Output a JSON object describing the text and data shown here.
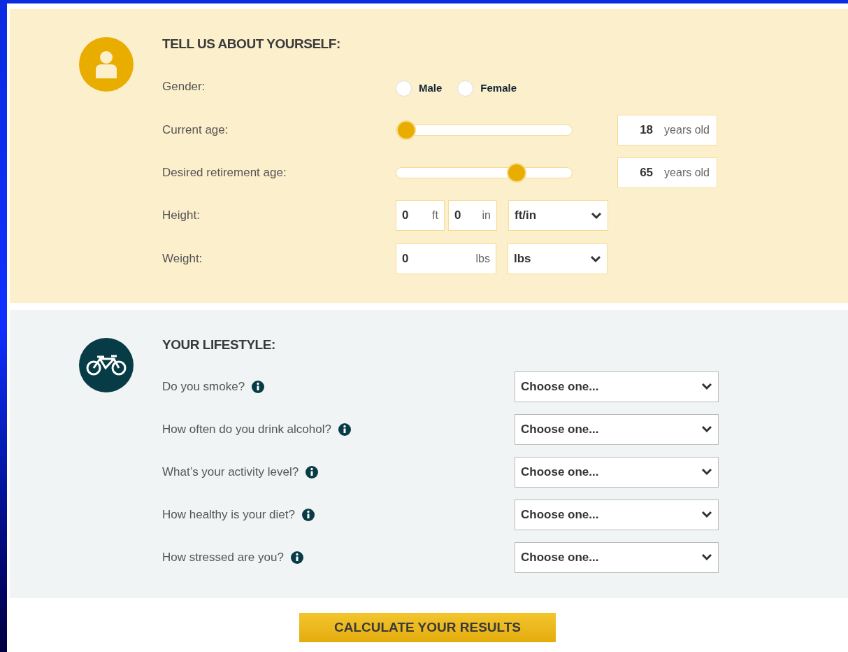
{
  "about": {
    "title": "TELL US ABOUT YOURSELF:",
    "gender": {
      "label": "Gender:",
      "options": [
        {
          "label": "Male",
          "selected": false
        },
        {
          "label": "Female",
          "selected": false
        }
      ]
    },
    "sliders": [
      {
        "label": "Current age:",
        "level": 0,
        "value": "18",
        "unit": "years old"
      },
      {
        "label": "Desired retirement age:",
        "level": 0.71,
        "value": "65",
        "unit": "years old"
      }
    ],
    "height": {
      "label": "Height:",
      "fields": [
        {
          "value": "0",
          "unit": "ft"
        },
        {
          "value": "0",
          "unit": "in"
        }
      ],
      "select": "ft/in"
    },
    "weight": {
      "label": "Weight:",
      "fields": [
        {
          "value": "0",
          "unit": "lbs"
        }
      ],
      "select": "lbs"
    }
  },
  "lifestyle": {
    "title": "YOUR LIFESTYLE:",
    "questions": [
      {
        "label": "Do you smoke?",
        "select": "Choose one..."
      },
      {
        "label": "How often do you drink alcohol?",
        "select": "Choose one..."
      },
      {
        "label": "What’s your activity level?",
        "select": "Choose one..."
      },
      {
        "label": "How healthy is your diet?",
        "select": "Choose one..."
      },
      {
        "label": "How stressed are you?",
        "select": "Choose one..."
      }
    ]
  },
  "button": "CALCULATE YOUR RESULTS"
}
